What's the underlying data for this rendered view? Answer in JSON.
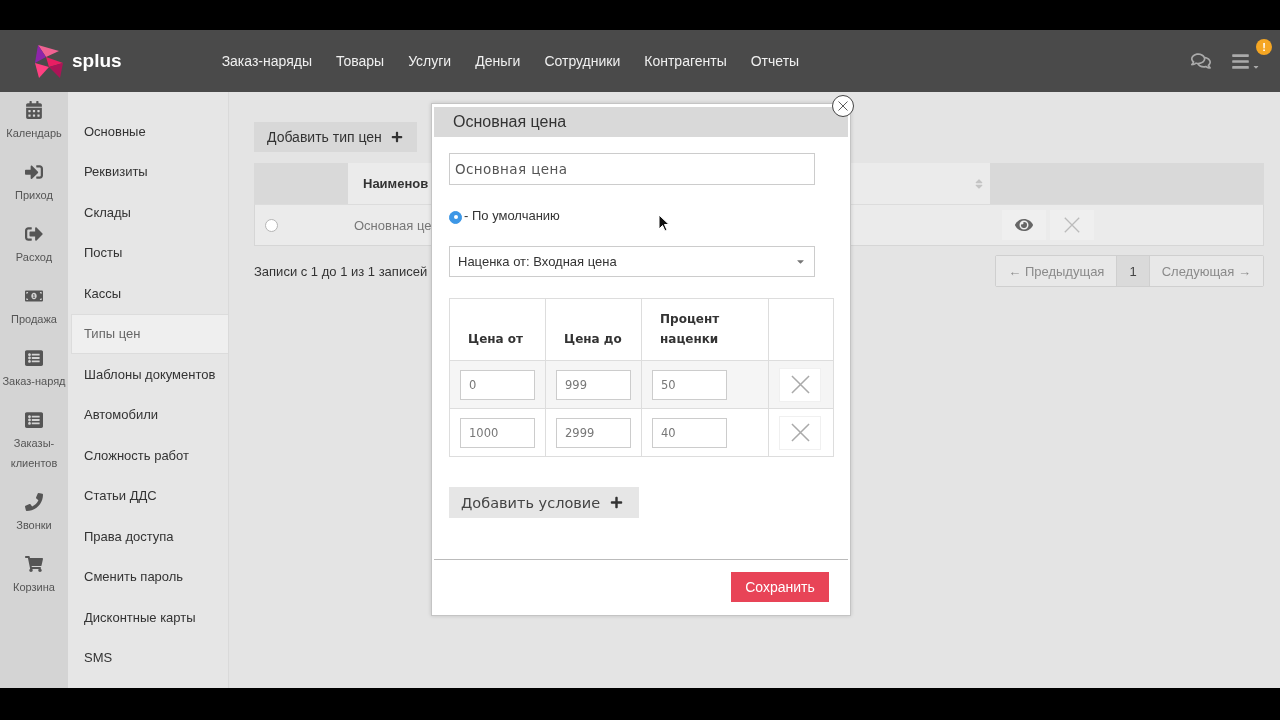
{
  "header": {
    "logo_text": "splus",
    "nav": [
      "Заказ-наряды",
      "Товары",
      "Услуги",
      "Деньги",
      "Сотрудники",
      "Контрагенты",
      "Отчеты"
    ],
    "notification_badge": "!"
  },
  "icon_sidebar": {
    "items": [
      "Календарь",
      "Приход",
      "Расход",
      "Продажа",
      "Заказ-наряд",
      "Заказы-клиентов",
      "Звонки",
      "Корзина"
    ]
  },
  "settings_menu": {
    "items": [
      {
        "label": "Основные",
        "selected": false
      },
      {
        "label": "Реквизиты",
        "selected": false
      },
      {
        "label": "Склады",
        "selected": false
      },
      {
        "label": "Посты",
        "selected": false
      },
      {
        "label": "Кассы",
        "selected": false
      },
      {
        "label": "Типы цен",
        "selected": true
      },
      {
        "label": "Шаблоны документов",
        "selected": false
      },
      {
        "label": "Автомобили",
        "selected": false
      },
      {
        "label": "Сложность работ",
        "selected": false
      },
      {
        "label": "Статьи ДДС",
        "selected": false
      },
      {
        "label": "Права доступа",
        "selected": false
      },
      {
        "label": "Сменить пароль",
        "selected": false
      },
      {
        "label": "Дисконтные карты",
        "selected": false
      },
      {
        "label": "SMS",
        "selected": false
      }
    ]
  },
  "main": {
    "add_button": "Добавить тип цен",
    "table": {
      "columns": [
        "Наименов"
      ],
      "rows": [
        {
          "selected": false,
          "cells": [
            "Основная це"
          ]
        }
      ]
    },
    "records_info": "Записи с 1 до 1 из 1 записей",
    "pagination": {
      "previous": {
        "label": "← Предыдущая",
        "disabled": true
      },
      "pages": [
        {
          "label": "1",
          "selected": true
        }
      ],
      "next": {
        "label": "Следующая →",
        "disabled": true
      }
    }
  },
  "modal": {
    "title": "Основная цена",
    "name_field": {
      "value": "Основная цена"
    },
    "default_option": {
      "label": "- По умолчанию",
      "checked": true
    },
    "markup_select": {
      "value": "Наценка от: Входная цена"
    },
    "conditions_table": {
      "columns": [
        "Цена от",
        "Цена до",
        "Процент наценки"
      ],
      "rows": [
        {
          "cells": [
            "0",
            "999",
            "50"
          ]
        },
        {
          "cells": [
            "1000",
            "2999",
            "40"
          ]
        }
      ]
    },
    "add_condition_button": "Добавить условие",
    "save_button": "Сохранить"
  }
}
